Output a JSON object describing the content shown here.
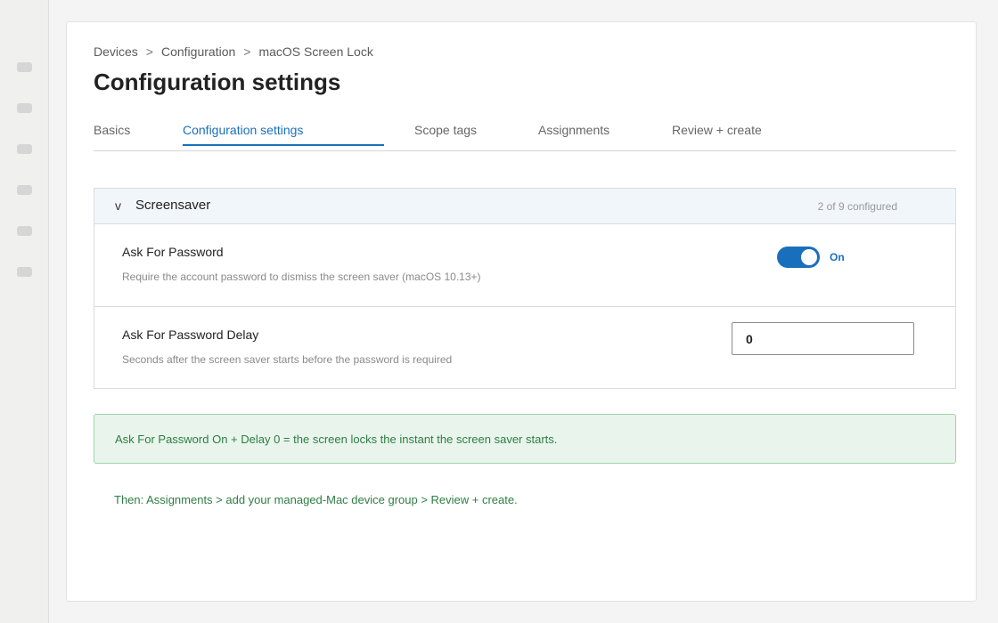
{
  "rail": {
    "icons": [
      "nav-item-icon",
      "nav-item-icon",
      "nav-item-icon",
      "nav-item-icon",
      "nav-item-icon",
      "nav-item-icon"
    ]
  },
  "breadcrumb": {
    "items": [
      "Devices",
      "Configuration",
      "macOS Screen Lock"
    ],
    "separator": ">"
  },
  "page": {
    "title": "Configuration settings"
  },
  "tabs": [
    {
      "label": "Basics",
      "active": false
    },
    {
      "label": "Configuration settings",
      "active": true
    },
    {
      "label": "Scope tags",
      "active": false
    },
    {
      "label": "Assignments",
      "active": false
    },
    {
      "label": "Review + create",
      "active": false
    }
  ],
  "section": {
    "chevron": "v",
    "title": "Screensaver",
    "count": "2 of 9 configured",
    "settings": [
      {
        "label": "Ask For Password",
        "description": "Require the account password to dismiss the screen saver (macOS 10.13+)",
        "toggle_state": "On"
      },
      {
        "label": "Ask For Password Delay",
        "description": "Seconds after the screen saver starts before the password is required",
        "value": "0"
      }
    ]
  },
  "callout": {
    "text": "Ask For Password On + Delay 0 = the screen locks the instant the screen saver starts."
  },
  "next_step": {
    "text": "Then: Assignments > add your managed-Mac device group > Review + create."
  },
  "colors": {
    "accent": "#1a6fbd",
    "success_bg": "#e9f5ec",
    "success_text": "#2e7d43",
    "section_header_bg": "#f1f6fb"
  }
}
